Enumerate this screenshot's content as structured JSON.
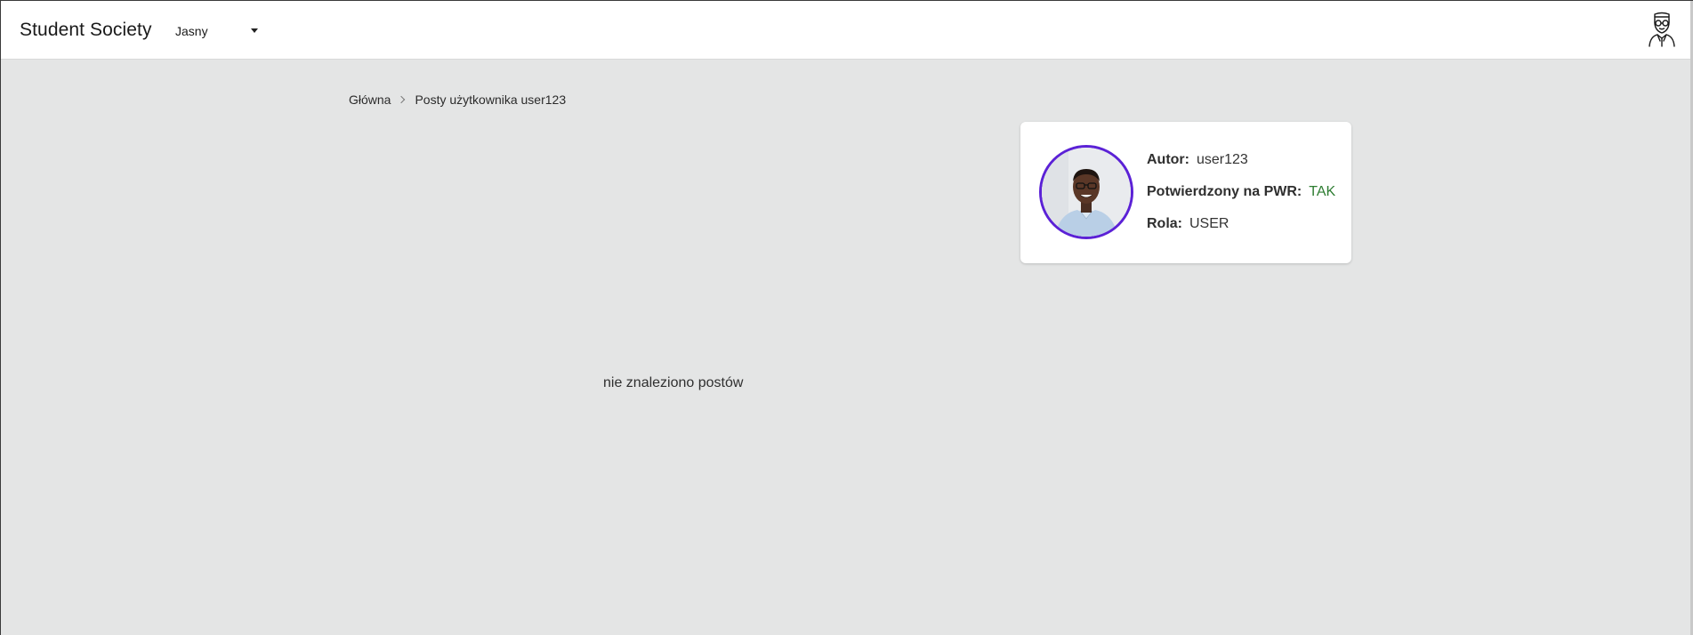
{
  "header": {
    "brand": "Student Society",
    "theme_select": {
      "selected": "Jasny"
    },
    "user_menu_icon": "student-avatar-icon"
  },
  "breadcrumb": {
    "items": [
      "Główna",
      "Posty użytkownika user123"
    ]
  },
  "author_card": {
    "photo_icon": "author-photo",
    "author_label": "Autor:",
    "author_value": "user123",
    "verified_label": "Potwierdzony na PWR:",
    "verified_value": "TAK",
    "role_label": "Rola:",
    "role_value": "USER"
  },
  "posts": {
    "empty_message": "nie znaleziono postów"
  },
  "colors": {
    "page_bg": "#e4e5e5",
    "header_bg": "#ffffff",
    "avatar_ring": "#5b21d6",
    "verified_text": "#2e7d32"
  }
}
